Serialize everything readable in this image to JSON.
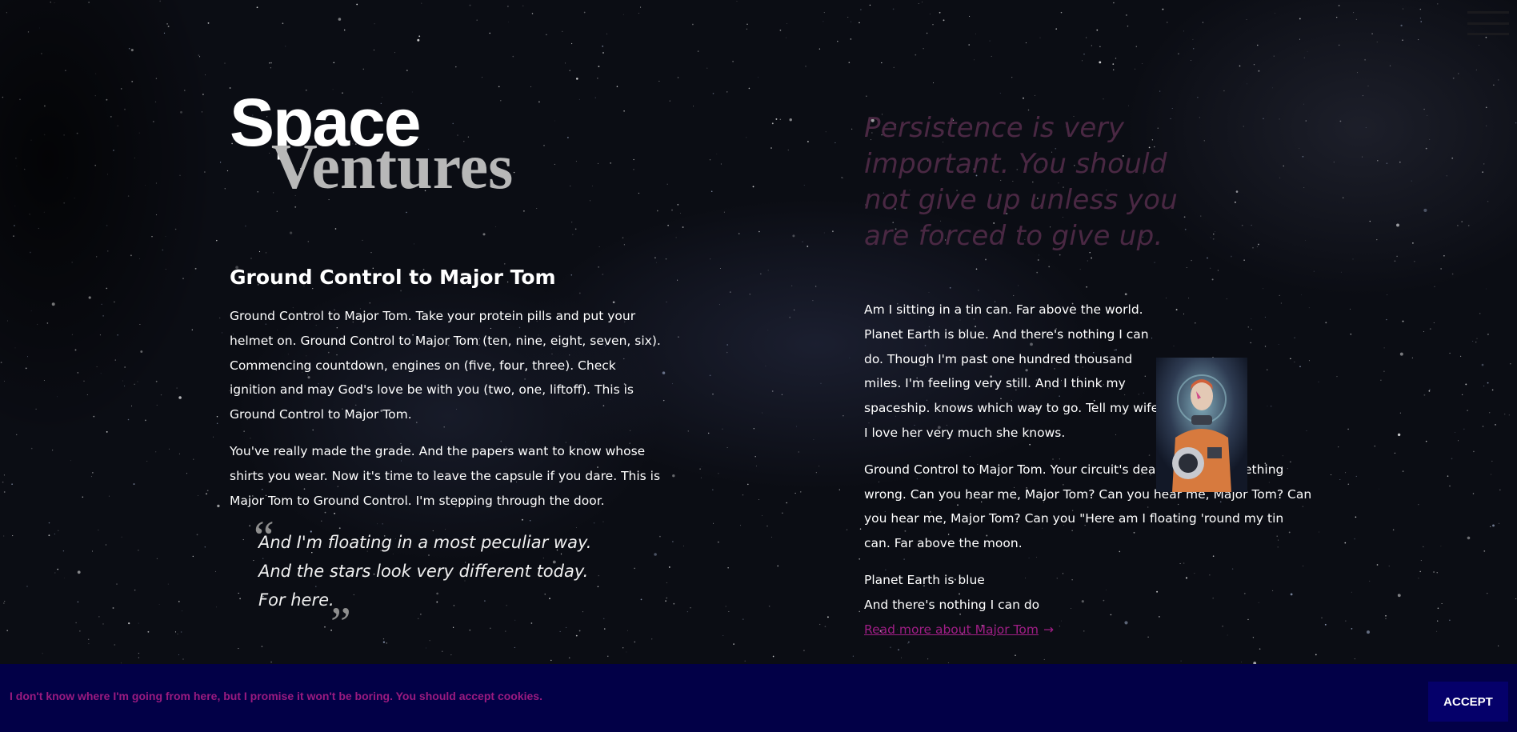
{
  "logo": {
    "line1": "Space",
    "line2": "Ventures"
  },
  "menu": {
    "icon": "hamburger-menu-icon"
  },
  "article_left": {
    "heading": "Ground Control to Major Tom",
    "paragraphs": [
      "Ground Control to Major Tom. Take your protein pills and put your helmet on. Ground Control to Major Tom (ten, nine, eight, seven, six). Commencing countdown, engines on (five, four, three). Check ignition and may God's love be with you (two, one, liftoff). This is Ground Control to Major Tom.",
      "You've really made the grade. And the papers want to know whose shirts you wear. Now it's time to leave the capsule if you dare. This is Major Tom to Ground Control. I'm stepping through the door."
    ],
    "quote": {
      "open_mark": "“",
      "close_mark": "”",
      "lines": [
        "And I'm floating in a most peculiar way.",
        "And the stars look very different today.",
        "For here."
      ]
    }
  },
  "article_right": {
    "pull_quote": "Persistence is very important. You should not give up unless you are forced to give up.",
    "paragraphs": [
      "Am I sitting in a tin can. Far above the world. Planet Earth is blue. And there's nothing I can do. Though I'm past one hundred thousand miles. I'm feeling very still. And I think my spaceship. knows which way to go. Tell my wife I love her very much she knows.",
      "Ground Control to Major Tom. Your circuit's dead, there's something wrong. Can you hear me, Major Tom? Can you hear me, Major Tom? Can you hear me, Major Tom? Can you \"Here am I floating 'round my tin can. Far above the moon."
    ],
    "lines": [
      "Planet Earth is blue",
      "And there's nothing I can do"
    ],
    "read_more": "Read more about Major Tom",
    "read_more_arrow": "→",
    "image": "astronaut-portrait"
  },
  "cookie": {
    "message": "I don't know where I'm going from here, but I promise it won't be boring. You should accept cookies.",
    "accept_label": "ACCEPT"
  },
  "colors": {
    "background": "#0b0d14",
    "accent_magenta": "#a01e86",
    "pull_quote": "#4a2843",
    "cookie_bar": "#020047",
    "accept_button": "#05006a",
    "logo_secondary": "#b8b8b8"
  }
}
